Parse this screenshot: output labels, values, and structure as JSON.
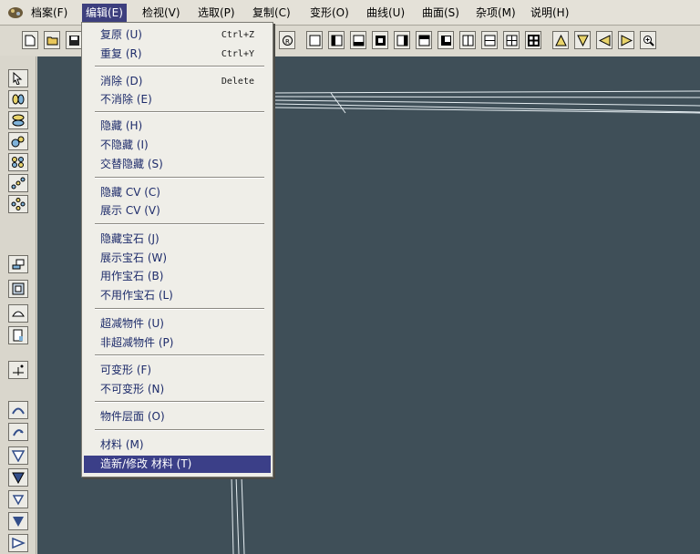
{
  "menubar": {
    "items": [
      "档案(F)",
      "编辑(E)",
      "检视(V)",
      "选取(P)",
      "复制(C)",
      "变形(O)",
      "曲线(U)",
      "曲面(S)",
      "杂项(M)",
      "说明(H)"
    ]
  },
  "edit_menu": {
    "undo": {
      "label": "复原 (U)",
      "shortcut": "Ctrl+Z"
    },
    "redo": {
      "label": "重复 (R)",
      "shortcut": "Ctrl+Y"
    },
    "delete": {
      "label": "消除 (D)",
      "shortcut": "Delete"
    },
    "undelete": {
      "label": "不消除 (E)"
    },
    "hide": {
      "label": "隐藏 (H)"
    },
    "unhide": {
      "label": "不隐藏 (I)"
    },
    "swap_hide": {
      "label": "交替隐藏 (S)"
    },
    "hide_cv": {
      "label": "隐藏 CV (C)"
    },
    "show_cv": {
      "label": "展示 CV (V)"
    },
    "hide_gem": {
      "label": "隐藏宝石 (J)"
    },
    "show_gem": {
      "label": "展示宝石 (W)"
    },
    "use_as_gem": {
      "label": "用作宝石 (B)"
    },
    "not_gem": {
      "label": "不用作宝石 (L)"
    },
    "super_object": {
      "label": "超减物件 (U)"
    },
    "non_super_object": {
      "label": "非超减物件 (P)"
    },
    "deformable": {
      "label": "可变形 (F)"
    },
    "non_deformable": {
      "label": "不可变形 (N)"
    },
    "object_layer": {
      "label": "物件层面 (O)"
    },
    "material": {
      "label": "材料 (M)"
    },
    "edit_material": {
      "label": "造新/修改 材料 (T)"
    }
  },
  "icons": {
    "app": "app-logo-icon",
    "toolbar": [
      "new-file-icon",
      "open-folder-icon",
      "save-icon",
      "render-icon",
      "view-frame-icon",
      "view-left-icon",
      "view-bottom-icon",
      "view-center-icon",
      "view-right-icon",
      "view-top-icon",
      "view-front-icon",
      "split-vertical-icon",
      "split-horizontal-icon",
      "grid-four-icon",
      "grid-quad-icon",
      "triangle-up-icon",
      "triangle-down-icon",
      "triangle-left-icon",
      "triangle-right-icon",
      "zoom-icon"
    ],
    "left": [
      "select-arrow-icon",
      "select-points-icon",
      "stack-icon",
      "select-group-icon",
      "grid-dots-icon",
      "diagonal-dots-icon",
      "ring-dots-icon",
      "move-layer-icon",
      "panel-icon",
      "arc-icon",
      "page-icon",
      "add-point-icon",
      "curve-up-icon",
      "curve-arrow-icon",
      "triangle-outline-icon",
      "triangle-filled-icon",
      "triangle-small-icon",
      "triangle-solid-icon",
      "triangle-edge-icon"
    ]
  },
  "colors": {
    "viewport": "#3f4f58",
    "menu_highlight": "#3b3f88"
  }
}
